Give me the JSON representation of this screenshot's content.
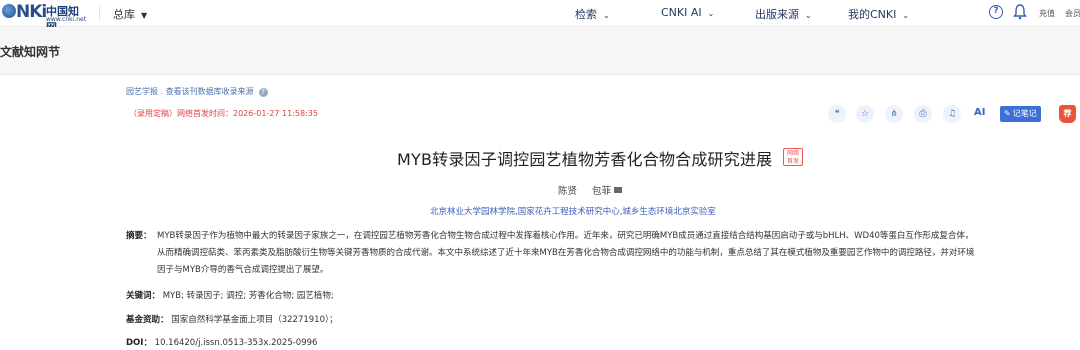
{
  "header": {
    "logo_cn": "中国知网",
    "logo_url": "www.cnki.net",
    "library_label": "总库",
    "nav": [
      {
        "label": "检索"
      },
      {
        "label": "CNKI AI"
      },
      {
        "label": "出版来源"
      },
      {
        "label": "我的CNKI"
      }
    ],
    "recharge_label": "充值",
    "member_label": "会员"
  },
  "section": {
    "title": "文献知网节"
  },
  "article": {
    "breadcrumb": "园艺学报 .   查看该刊数据库收录来源",
    "pub_status": "（录用定稿）网络首发时间：2026-01-27 11:58:35",
    "toolbar": {
      "ai_label": "AI",
      "note_label": "记笔记",
      "red_badge_label": "荐"
    },
    "title": "MYB转录因子调控园艺植物芳香化合物合成研究进展",
    "title_tag_line1": "网络",
    "title_tag_line2": "首发",
    "authors": [
      "陈贤",
      "包菲"
    ],
    "affiliation": "北京林业大学园林学院,国家花卉工程技术研究中心,城乡生态环境北京实验室",
    "abstract_label": "摘要：",
    "abstract_lines": [
      "MYB转录因子作为植物中最大的转录因子家族之一，在调控园艺植物芳香化合物生物合成过程中发挥着核心作用。近年来，研究已明确MYB成员通过直接结合结构基因启动子或与bHLH、WD40等蛋白互作形成复合体，",
      "从而精确调控萜类、苯丙素类及脂肪酸衍生物等关键芳香物质的合成代谢。本文中系统综述了近十年来MYB在芳香化合物合成调控网络中的功能与机制，重点总结了其在模式植物及重要园艺作物中的调控路径，并对环境",
      "因子与MYB介导的香气合成调控提出了展望。"
    ],
    "keywords_label": "关键词：",
    "keywords": "MYB;  转录因子;  调控;  芳香化合物;  园艺植物;",
    "funding_label": "基金资助：",
    "funding": "国家自然科学基金面上项目（32271910）；",
    "doi_label": "DOI：",
    "doi": "10.16420/j.issn.0513-353x.2025-0996"
  }
}
